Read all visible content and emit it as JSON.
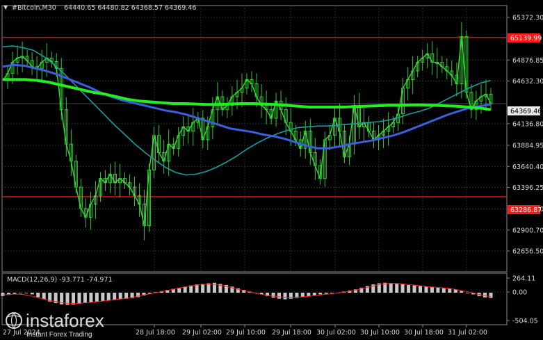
{
  "header": {
    "symbol": "#Bitcoin,M30",
    "ohlc": "64440.65 64480.82 64368.57 64369.46"
  },
  "macd_label": "MACD(12,26,9) -93.771 -74.971",
  "watermark": {
    "brand": "instaforex",
    "tagline": "Instant Forex Trading"
  },
  "colors": {
    "background": "#000000",
    "grid": "#2c2c2c",
    "bull_candle": "#33dd33",
    "bear_candle": "#33dd33",
    "ma_fast": "#17a0a0",
    "ma_mid": "#3a60e0",
    "ma_slow": "#22ee22",
    "level_line": "#ff1a1a",
    "price_tag": "#e8e8e8",
    "macd_hist": "#c8c8c8",
    "macd_signal": "#ff2222"
  },
  "chart_data": [
    {
      "type": "candlestick",
      "title": "#Bitcoin,M30",
      "ylim": [
        62656.5,
        65450
      ],
      "y_ticks": [
        "65372.30",
        "64876.85",
        "64632.30",
        "64136.80",
        "63884.95",
        "63640.40",
        "63396.25",
        "63144.90",
        "62900.70",
        "62656.50"
      ],
      "x_ticks": [
        "28 Jul 18:00",
        "29 Jul 02:00",
        "29 Jul 10:00",
        "29 Jul 18:00",
        "30 Jul 02:00",
        "30 Jul 10:00",
        "30 Jul 18:00",
        "31 Jul 02:00"
      ],
      "overlapped_x_label": "27 Jul 2024",
      "price_tags": {
        "resistance": "65139.99",
        "current": "64369.46",
        "support": "63286.87"
      },
      "levels": {
        "resistance": 65139.99,
        "support": 63286.87
      },
      "close": [
        64640,
        64720,
        64850,
        64900,
        64920,
        64870,
        64800,
        64780,
        64850,
        64900,
        64860,
        64780,
        64300,
        63900,
        63700,
        63400,
        63150,
        63050,
        63200,
        63300,
        63500,
        63450,
        63550,
        63450,
        63500,
        63450,
        63400,
        63300,
        63200,
        62950,
        63600,
        64000,
        63800,
        63700,
        63900,
        63850,
        64000,
        64100,
        64050,
        64150,
        64200,
        63950,
        64100,
        64300,
        64450,
        64300,
        64350,
        64450,
        64500,
        64550,
        64650,
        64600,
        64450,
        64350,
        64300,
        64200,
        64400,
        64300,
        64150,
        64050,
        63950,
        63850,
        64050,
        63800,
        63650,
        63500,
        63950,
        64000,
        64200,
        64050,
        63750,
        63900,
        64350,
        64100,
        64150,
        64050,
        63950,
        64000,
        64050,
        64100,
        64150,
        64250,
        64550,
        64650,
        64750,
        64850,
        64900,
        64950,
        64850,
        64850,
        64800,
        64750,
        64700,
        64600,
        65150,
        64500,
        64300,
        64400,
        64450,
        64480,
        64369.46
      ],
      "ma_fast": [
        65030,
        65040,
        65020,
        64990,
        64920,
        64830,
        64720,
        64600,
        64480,
        64360,
        64240,
        64120,
        64010,
        63900,
        63800,
        63710,
        63630,
        63570,
        63540,
        63550,
        63580,
        63630,
        63690,
        63760,
        63840,
        63910,
        63970,
        64020,
        64060,
        64090,
        64100,
        64110,
        64110,
        64120,
        64130,
        64140,
        64150,
        64160,
        64180,
        64210,
        64250,
        64280,
        64320,
        64380,
        64440,
        64500,
        64560,
        64610,
        64640
      ],
      "ma_mid": [
        64800,
        64820,
        64810,
        64780,
        64750,
        64710,
        64660,
        64610,
        64560,
        64500,
        64450,
        64410,
        64380,
        64350,
        64320,
        64290,
        64270,
        64240,
        64200,
        64160,
        64120,
        64080,
        64060,
        64040,
        64010,
        63990,
        63960,
        63920,
        63880,
        63850,
        63850,
        63870,
        63900,
        63920,
        63940,
        63970,
        64000,
        64040,
        64090,
        64140,
        64190,
        64240,
        64280,
        64320,
        64340,
        64360
      ],
      "ma_slow": [
        64650,
        64650,
        64650,
        64640,
        64620,
        64590,
        64560,
        64530,
        64500,
        64480,
        64450,
        64420,
        64400,
        64390,
        64380,
        64370,
        64370,
        64365,
        64360,
        64360,
        64365,
        64370,
        64370,
        64365,
        64360,
        64350,
        64340,
        64330,
        64330,
        64330,
        64330,
        64335,
        64340,
        64345,
        64350,
        64350,
        64355,
        64355,
        64350,
        64345,
        64340,
        64330,
        64320,
        64300
      ]
    },
    {
      "type": "bar",
      "title": "MACD(12,26,9)",
      "ylim": [
        -504.05,
        264.11
      ],
      "y_ticks": [
        "264.11",
        "0.00",
        "-504.05"
      ],
      "histogram": [
        -60,
        -40,
        -20,
        -10,
        -5,
        -30,
        -80,
        -120,
        -160,
        -190,
        -210,
        -220,
        -215,
        -200,
        -185,
        -170,
        -160,
        -150,
        -140,
        -130,
        -120,
        -110,
        -100,
        -80,
        -50,
        -20,
        10,
        30,
        50,
        70,
        90,
        110,
        130,
        150,
        160,
        170,
        180,
        160,
        140,
        110,
        80,
        50,
        20,
        0,
        -30,
        -60,
        -90,
        -110,
        -120,
        -110,
        -95,
        -80,
        -60,
        -45,
        -30,
        -20,
        -10,
        0,
        20,
        40,
        60,
        90,
        120,
        150,
        170,
        180,
        175,
        165,
        155,
        140,
        130,
        120,
        110,
        100,
        90,
        80,
        70,
        60,
        30,
        0,
        -30,
        -60,
        -85,
        -94
      ],
      "signal": [
        -40,
        -30,
        -25,
        -35,
        -60,
        -90,
        -120,
        -150,
        -175,
        -190,
        -195,
        -190,
        -180,
        -168,
        -155,
        -140,
        -125,
        -110,
        -90,
        -65,
        -40,
        -15,
        10,
        35,
        60,
        85,
        110,
        130,
        148,
        155,
        150,
        130,
        100,
        70,
        40,
        10,
        -15,
        -40,
        -60,
        -75,
        -82,
        -85,
        -80,
        -70,
        -55,
        -40,
        -25,
        -10,
        5,
        25,
        50,
        80,
        110,
        140,
        160,
        170,
        165,
        155,
        140,
        125,
        110,
        100,
        90,
        80,
        60,
        35,
        10,
        -20,
        -50,
        -75
      ]
    }
  ]
}
